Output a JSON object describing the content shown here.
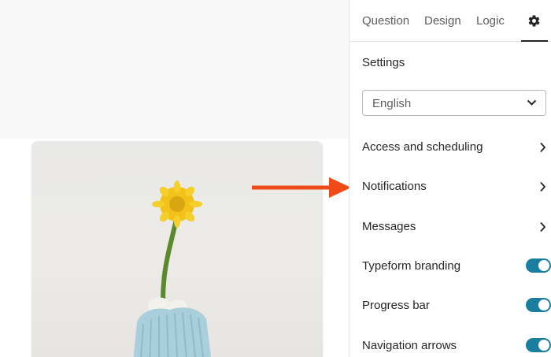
{
  "tabs": {
    "question": "Question",
    "design": "Design",
    "logic": "Logic",
    "settings_icon": "gear-icon"
  },
  "settings": {
    "title": "Settings",
    "language": {
      "value": "English",
      "icon": "chevron-down-icon"
    },
    "links": [
      {
        "label": "Access and scheduling",
        "icon": "chevron-right-icon"
      },
      {
        "label": "Notifications",
        "icon": "chevron-right-icon"
      },
      {
        "label": "Messages",
        "icon": "chevron-right-icon"
      }
    ],
    "toggles": [
      {
        "label": "Typeform branding",
        "enabled": true
      },
      {
        "label": "Progress bar",
        "enabled": true
      },
      {
        "label": "Navigation arrows",
        "enabled": true
      }
    ]
  },
  "colors": {
    "toggle_on": "#1a7ea0",
    "annotation_arrow": "#f04a16",
    "text_primary": "#262627",
    "text_secondary": "#5e5e5e"
  }
}
